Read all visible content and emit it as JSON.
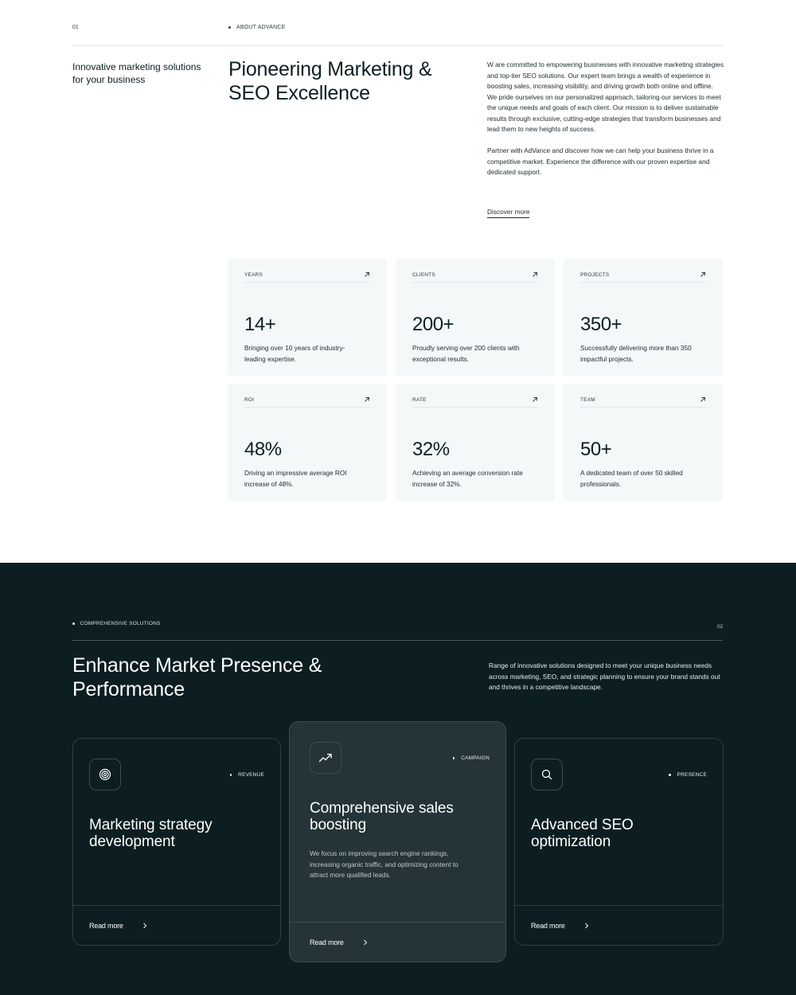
{
  "about": {
    "section_number": "01",
    "eyebrow": "ABOUT ADVANCE",
    "tagline": "Innovative marketing solutions for your business",
    "headline": "Pioneering Marketing & SEO Excellence",
    "paragraphs": [
      "W are committed to empowering businesses with innovative marketing strategies and top-tier SEO solutions. Our expert team brings a wealth of experience in boosting sales, increasing visibility, and driving growth both online and offline. We pride ourselves on our personalized approach, tailoring our services to meet the unique needs and goals of each client. Our mission is to deliver sustainable results through exclusive, cutting-edge strategies that transform businesses and lead them to new heights of success.",
      "Partner with AdVance and discover how we can help your business thrive in a competitive market. Experience the difference with our proven expertise and dedicated support."
    ],
    "discover_link": "Discover more",
    "stats": [
      {
        "label": "YEARS",
        "value": "14+",
        "description": "Bringing over 10 years of industry-leading expertise.",
        "icon": "arrow-up-right-icon"
      },
      {
        "label": "CLIENTS",
        "value": "200+",
        "description": "Proudly serving over 200 clients with exceptional results.",
        "icon": "arrow-up-right-icon"
      },
      {
        "label": "PROJECTS",
        "value": "350+",
        "description": "Successfully delivering more than 350 impactful projects.",
        "icon": "arrow-up-right-icon"
      },
      {
        "label": "ROI",
        "value": "48%",
        "description": "Driving an impressive average ROI increase of 48%.",
        "icon": "arrow-up-right-icon"
      },
      {
        "label": "RATE",
        "value": "32%",
        "description": "Achieving an average conversion rate increase of 32%.",
        "icon": "arrow-up-right-icon"
      },
      {
        "label": "TEAM",
        "value": "50+",
        "description": "A dedicated team of over 50 skilled professionals.",
        "icon": "arrow-up-right-icon"
      }
    ]
  },
  "solutions": {
    "eyebrow": "COMPREHENSIVE SOLUTIONS",
    "section_number": "02",
    "headline": "Enhance Market Presence & Performance",
    "intro": "Range of innovative solutions designed to meet your unique business needs across marketing, SEO, and strategic planning to ensure your brand stands out and thrives in a competitive landscape.",
    "cards": [
      {
        "icon": "target-icon",
        "tag": "REVENUE",
        "title": "Marketing strategy development",
        "description": "",
        "cta": "Read more",
        "featured": false
      },
      {
        "icon": "trending-up-icon",
        "tag": "CAMPAIGN",
        "title": "Comprehensive sales boosting",
        "description": "We focus on improving search engine rankings, increasing organic traffic, and optimizing content to attract more qualified leads.",
        "cta": "Read more",
        "featured": true
      },
      {
        "icon": "search-icon",
        "tag": "PRESENCE",
        "title": "Advanced SEO optimization",
        "description": "",
        "cta": "Read more",
        "featured": false
      }
    ]
  },
  "colors": {
    "dark_background": "#0c1e22",
    "featured_card": "#243438",
    "stat_card": "#f4f8f9",
    "text_dark": "#0d1e22"
  }
}
